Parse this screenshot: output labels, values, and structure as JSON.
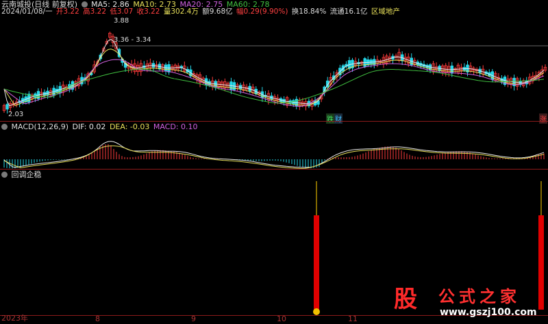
{
  "header": {
    "stock_name": "云南城投(日线 前复权)",
    "ma5": "MA5: 2.86",
    "ma10": "MA10: 2.73",
    "ma20": "MA20: 2.75",
    "ma60": "MA60: 2.78"
  },
  "infobar": {
    "date": "2024/01/08/一",
    "open": "开3.22",
    "high": "高3.22",
    "low": "低3.07",
    "close": "收3.22",
    "volume": "量302.4万",
    "amount": "额9.68亿",
    "change": "幅0.29(9.90%)",
    "turnover": "换18.84%",
    "float": "流通16.1亿",
    "sector": "区域地产"
  },
  "price_labels": {
    "high_mark": "3.88",
    "range_mark": "3.36 - 3.34",
    "low_mark": "2.03"
  },
  "badges": {
    "die": "跌",
    "cai": "财",
    "zhang": "涨"
  },
  "macd_header": {
    "title": "MACD(12,26,9)",
    "dif": "DIF: 0.02",
    "dea": "DEA: -0.03",
    "macd": "MACD: 0.10"
  },
  "indicator_header": {
    "title": "回调企稳"
  },
  "x_axis": [
    "2023年",
    "8",
    "9",
    "10",
    "11"
  ],
  "watermark": {
    "logo_char": "股",
    "title": "公式之家",
    "url": "www.gszj100.com"
  },
  "colors": {
    "up": "#ff3b3b",
    "down": "#26d7e8",
    "ma5": "#e8e8e8",
    "ma10": "#e8e05a",
    "ma20": "#d060e0",
    "ma60": "#40c040"
  }
}
